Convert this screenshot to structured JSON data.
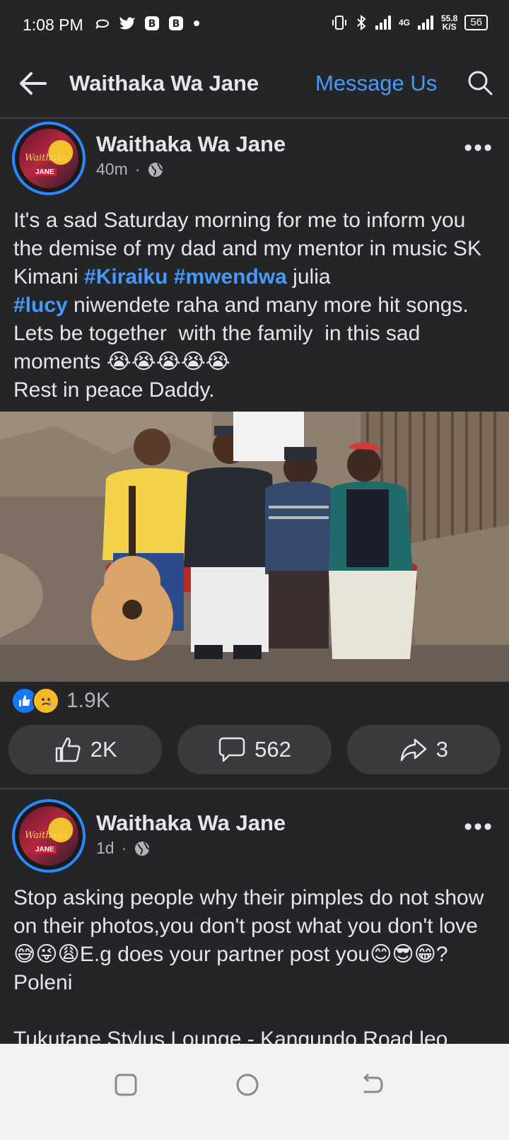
{
  "status_bar": {
    "time": "1:08 PM",
    "left_icons": [
      "whatsapp-business-icon",
      "twitter-icon",
      "b-app-icon",
      "b-app-icon",
      "dot-icon"
    ],
    "network_type": "4G",
    "net_speed_value": "55.8",
    "net_speed_unit": "K/S",
    "battery": "56"
  },
  "app_bar": {
    "title": "Waithaka Wa Jane",
    "message_button": "Message Us"
  },
  "posts": [
    {
      "author": "Waithaka Wa Jane",
      "time": "40m",
      "avatar_text": "Waithaka",
      "avatar_sub": "JANE",
      "text_segments": [
        {
          "t": "It's a sad Saturday morning for me to inform you the demise of my dad and my mentor in music SK Kimani ",
          "tag": false
        },
        {
          "t": "#Kiraiku",
          "tag": true
        },
        {
          "t": " ",
          "tag": false
        },
        {
          "t": "#mwendwa",
          "tag": true
        },
        {
          "t": " julia\n",
          "tag": false
        },
        {
          "t": "#lucy",
          "tag": true
        },
        {
          "t": " niwendete raha and many more hit songs. Lets be together  with the family  in this sad moments ",
          "tag": false
        },
        {
          "t": "😭😭😭😭😭",
          "tag": false,
          "emoji": true
        },
        {
          "t": "\nRest in peace Daddy.",
          "tag": false
        }
      ],
      "reaction_count": "1.9K",
      "like_count": "2K",
      "comment_count": "562",
      "share_count": "3"
    },
    {
      "author": "Waithaka Wa Jane",
      "time": "1d",
      "avatar_text": "Waithaka",
      "avatar_sub": "JANE",
      "text_segments": [
        {
          "t": "Stop asking people why their pimples do not show on their photos,you don't post what you don't love",
          "tag": false
        },
        {
          "t": "😅😜😩",
          "tag": false,
          "emoji": true
        },
        {
          "t": "E.g does your partner post you",
          "tag": false
        },
        {
          "t": "😊😎😁",
          "tag": false,
          "emoji": true
        },
        {
          "t": "? Poleni\n\nTukutane Stylus Lounge - Kangundo Road leo",
          "tag": false
        }
      ]
    }
  ],
  "colors": {
    "background": "#242526",
    "accent": "#4599ff",
    "text": "#e4e6eb",
    "secondary": "#b0b3b8",
    "button_bg": "#3a3b3c"
  }
}
